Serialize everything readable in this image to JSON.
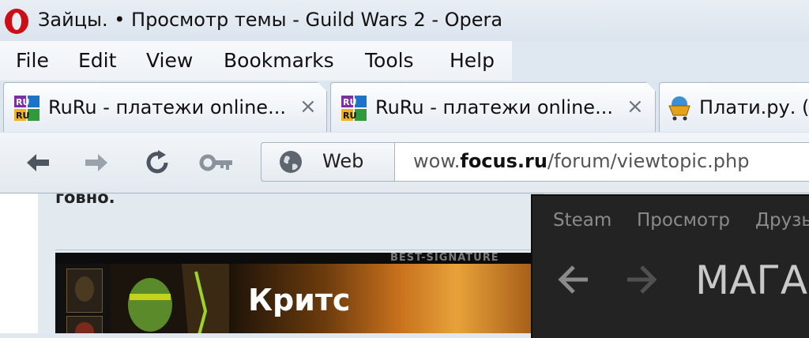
{
  "window": {
    "title": "Зайцы. • Просмотр темы - Guild Wars 2 - Opera"
  },
  "menu": {
    "items": [
      {
        "label": "File"
      },
      {
        "label": "Edit"
      },
      {
        "label": "View"
      },
      {
        "label": "Bookmarks"
      },
      {
        "label": "Tools"
      },
      {
        "label": "Help"
      }
    ]
  },
  "tabs": [
    {
      "label": "RuRu - платежи online...",
      "icon": "ruru-icon",
      "close": "×"
    },
    {
      "label": "RuRu - платежи online...",
      "icon": "ruru-icon",
      "close": "×"
    },
    {
      "label": "Плати.ру. (",
      "icon": "shopping-cart-icon"
    }
  ],
  "addressbar": {
    "search_engine": "Web",
    "url_prefix": "wow.",
    "url_domain": "focus.ru",
    "url_path": "/forum/viewtopic.php"
  },
  "page": {
    "post_text": "говно.",
    "signature_watermark": "BEST-SIGNATURE",
    "signature_name": "Критс"
  },
  "steam": {
    "menu": [
      {
        "label": "Steam"
      },
      {
        "label": "Просмотр"
      },
      {
        "label": "Друзь"
      }
    ],
    "page_title": "МАГА"
  },
  "colors": {
    "opera_red": "#cc0f16",
    "steam_bg": "#232323"
  }
}
